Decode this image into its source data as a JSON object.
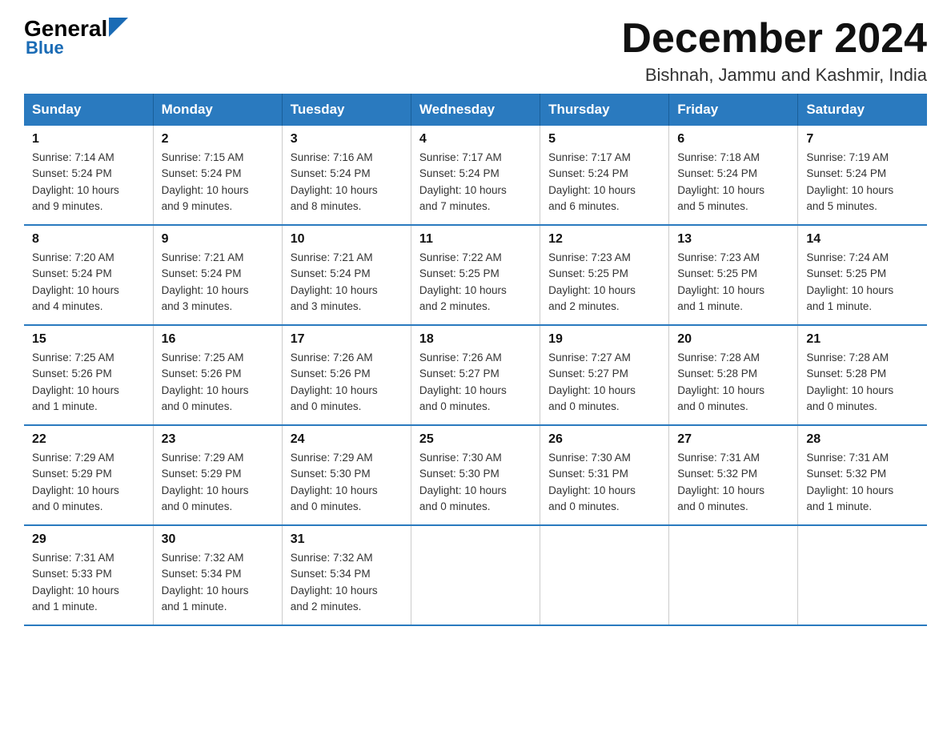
{
  "logo": {
    "text_general": "General",
    "text_blue": "Blue"
  },
  "header": {
    "title": "December 2024",
    "subtitle": "Bishnah, Jammu and Kashmir, India"
  },
  "days_of_week": [
    "Sunday",
    "Monday",
    "Tuesday",
    "Wednesday",
    "Thursday",
    "Friday",
    "Saturday"
  ],
  "weeks": [
    [
      {
        "day": "1",
        "info": "Sunrise: 7:14 AM\nSunset: 5:24 PM\nDaylight: 10 hours\nand 9 minutes."
      },
      {
        "day": "2",
        "info": "Sunrise: 7:15 AM\nSunset: 5:24 PM\nDaylight: 10 hours\nand 9 minutes."
      },
      {
        "day": "3",
        "info": "Sunrise: 7:16 AM\nSunset: 5:24 PM\nDaylight: 10 hours\nand 8 minutes."
      },
      {
        "day": "4",
        "info": "Sunrise: 7:17 AM\nSunset: 5:24 PM\nDaylight: 10 hours\nand 7 minutes."
      },
      {
        "day": "5",
        "info": "Sunrise: 7:17 AM\nSunset: 5:24 PM\nDaylight: 10 hours\nand 6 minutes."
      },
      {
        "day": "6",
        "info": "Sunrise: 7:18 AM\nSunset: 5:24 PM\nDaylight: 10 hours\nand 5 minutes."
      },
      {
        "day": "7",
        "info": "Sunrise: 7:19 AM\nSunset: 5:24 PM\nDaylight: 10 hours\nand 5 minutes."
      }
    ],
    [
      {
        "day": "8",
        "info": "Sunrise: 7:20 AM\nSunset: 5:24 PM\nDaylight: 10 hours\nand 4 minutes."
      },
      {
        "day": "9",
        "info": "Sunrise: 7:21 AM\nSunset: 5:24 PM\nDaylight: 10 hours\nand 3 minutes."
      },
      {
        "day": "10",
        "info": "Sunrise: 7:21 AM\nSunset: 5:24 PM\nDaylight: 10 hours\nand 3 minutes."
      },
      {
        "day": "11",
        "info": "Sunrise: 7:22 AM\nSunset: 5:25 PM\nDaylight: 10 hours\nand 2 minutes."
      },
      {
        "day": "12",
        "info": "Sunrise: 7:23 AM\nSunset: 5:25 PM\nDaylight: 10 hours\nand 2 minutes."
      },
      {
        "day": "13",
        "info": "Sunrise: 7:23 AM\nSunset: 5:25 PM\nDaylight: 10 hours\nand 1 minute."
      },
      {
        "day": "14",
        "info": "Sunrise: 7:24 AM\nSunset: 5:25 PM\nDaylight: 10 hours\nand 1 minute."
      }
    ],
    [
      {
        "day": "15",
        "info": "Sunrise: 7:25 AM\nSunset: 5:26 PM\nDaylight: 10 hours\nand 1 minute."
      },
      {
        "day": "16",
        "info": "Sunrise: 7:25 AM\nSunset: 5:26 PM\nDaylight: 10 hours\nand 0 minutes."
      },
      {
        "day": "17",
        "info": "Sunrise: 7:26 AM\nSunset: 5:26 PM\nDaylight: 10 hours\nand 0 minutes."
      },
      {
        "day": "18",
        "info": "Sunrise: 7:26 AM\nSunset: 5:27 PM\nDaylight: 10 hours\nand 0 minutes."
      },
      {
        "day": "19",
        "info": "Sunrise: 7:27 AM\nSunset: 5:27 PM\nDaylight: 10 hours\nand 0 minutes."
      },
      {
        "day": "20",
        "info": "Sunrise: 7:28 AM\nSunset: 5:28 PM\nDaylight: 10 hours\nand 0 minutes."
      },
      {
        "day": "21",
        "info": "Sunrise: 7:28 AM\nSunset: 5:28 PM\nDaylight: 10 hours\nand 0 minutes."
      }
    ],
    [
      {
        "day": "22",
        "info": "Sunrise: 7:29 AM\nSunset: 5:29 PM\nDaylight: 10 hours\nand 0 minutes."
      },
      {
        "day": "23",
        "info": "Sunrise: 7:29 AM\nSunset: 5:29 PM\nDaylight: 10 hours\nand 0 minutes."
      },
      {
        "day": "24",
        "info": "Sunrise: 7:29 AM\nSunset: 5:30 PM\nDaylight: 10 hours\nand 0 minutes."
      },
      {
        "day": "25",
        "info": "Sunrise: 7:30 AM\nSunset: 5:30 PM\nDaylight: 10 hours\nand 0 minutes."
      },
      {
        "day": "26",
        "info": "Sunrise: 7:30 AM\nSunset: 5:31 PM\nDaylight: 10 hours\nand 0 minutes."
      },
      {
        "day": "27",
        "info": "Sunrise: 7:31 AM\nSunset: 5:32 PM\nDaylight: 10 hours\nand 0 minutes."
      },
      {
        "day": "28",
        "info": "Sunrise: 7:31 AM\nSunset: 5:32 PM\nDaylight: 10 hours\nand 1 minute."
      }
    ],
    [
      {
        "day": "29",
        "info": "Sunrise: 7:31 AM\nSunset: 5:33 PM\nDaylight: 10 hours\nand 1 minute."
      },
      {
        "day": "30",
        "info": "Sunrise: 7:32 AM\nSunset: 5:34 PM\nDaylight: 10 hours\nand 1 minute."
      },
      {
        "day": "31",
        "info": "Sunrise: 7:32 AM\nSunset: 5:34 PM\nDaylight: 10 hours\nand 2 minutes."
      },
      {
        "day": "",
        "info": ""
      },
      {
        "day": "",
        "info": ""
      },
      {
        "day": "",
        "info": ""
      },
      {
        "day": "",
        "info": ""
      }
    ]
  ]
}
